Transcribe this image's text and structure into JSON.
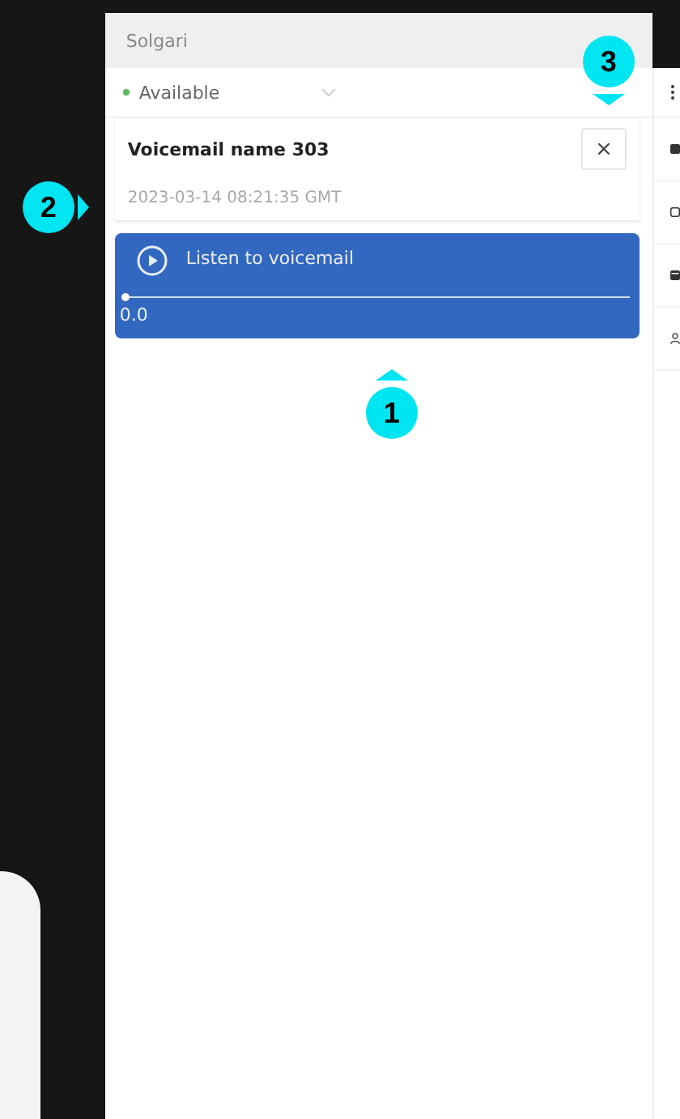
{
  "window": {
    "title": "Solgari"
  },
  "status": {
    "label": "Available",
    "color": "#5cb85c"
  },
  "voicemail": {
    "title": "Voicemail name 303",
    "timestamp": "2023-03-14 08:21:35 GMT",
    "close": "×"
  },
  "player": {
    "label": "Listen to voicemail",
    "level": 0,
    "time": "0.0"
  },
  "callouts": [
    {
      "number": "1"
    },
    {
      "number": "2"
    },
    {
      "number": "3"
    }
  ]
}
